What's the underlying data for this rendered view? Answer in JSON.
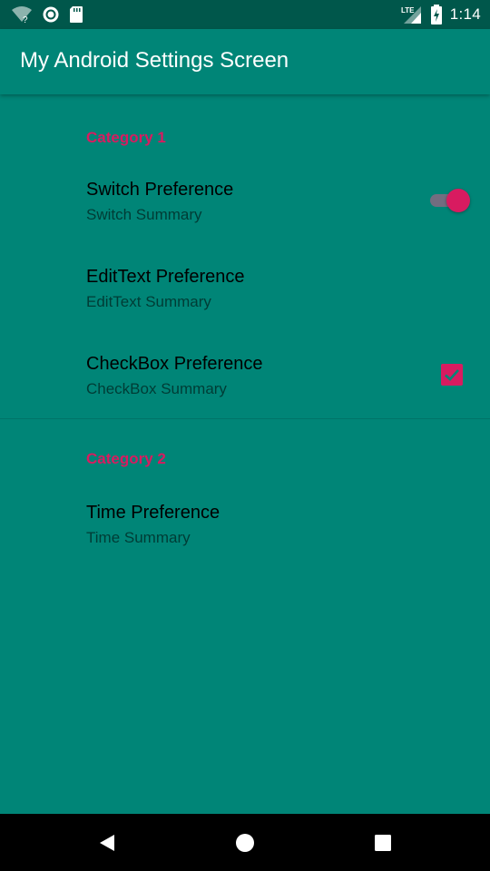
{
  "status_bar": {
    "time": "1:14",
    "network_label": "LTE",
    "icons": [
      "wifi-icon",
      "sync-icon",
      "sd-card-icon",
      "signal-icon",
      "battery-charging-icon"
    ]
  },
  "toolbar": {
    "title": "My Android Settings Screen"
  },
  "categories": [
    {
      "title": "Category 1",
      "items": [
        {
          "title": "Switch Preference",
          "summary": "Switch Summary",
          "widget": "switch",
          "checked": true
        },
        {
          "title": "EditText Preference",
          "summary": "EditText Summary",
          "widget": "none"
        },
        {
          "title": "CheckBox Preference",
          "summary": "CheckBox Summary",
          "widget": "checkbox",
          "checked": true
        }
      ]
    },
    {
      "title": "Category 2",
      "items": [
        {
          "title": "Time Preference",
          "summary": "Time Summary",
          "widget": "none"
        }
      ]
    }
  ],
  "nav_bar": {
    "buttons": [
      "back-icon",
      "home-icon",
      "recents-icon"
    ]
  },
  "colors": {
    "primary": "#008577",
    "primary_dark": "#00574B",
    "accent": "#D81B60"
  }
}
